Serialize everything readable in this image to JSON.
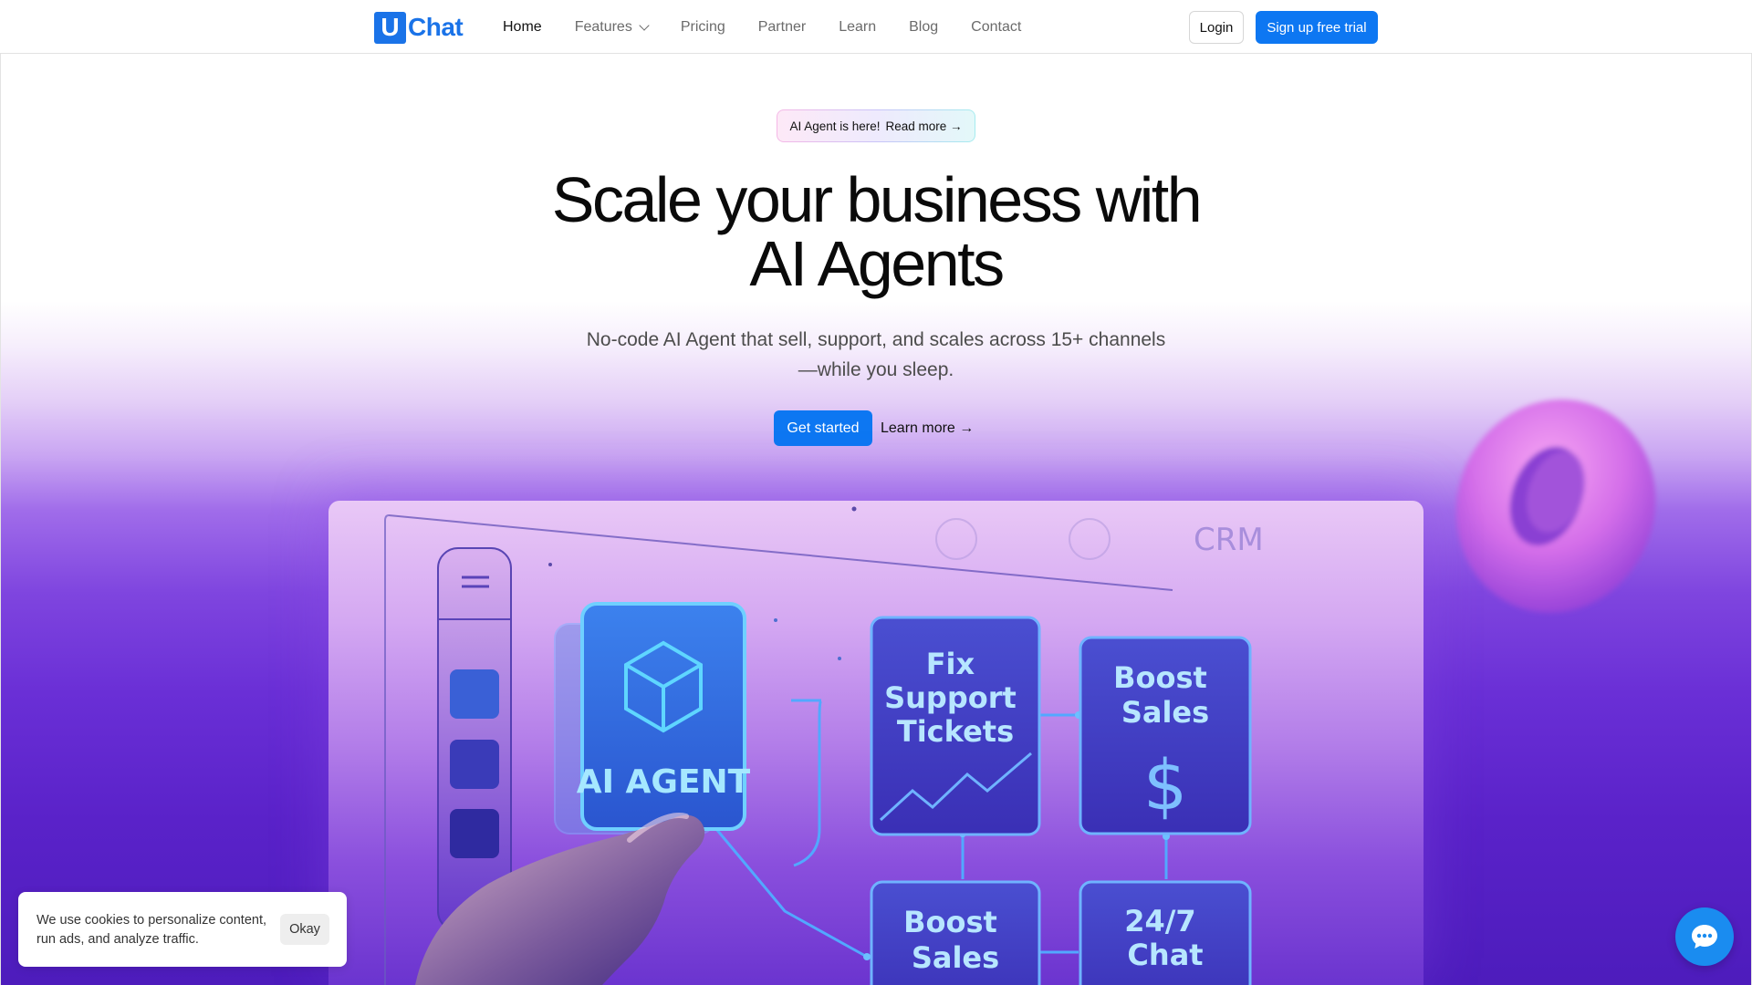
{
  "brand": {
    "logo_letter": "U",
    "logo_text": "Chat",
    "accent": "#1a73e8",
    "button_blue": "#0d77f2"
  },
  "nav": {
    "items": [
      {
        "label": "Home",
        "active": true
      },
      {
        "label": "Features",
        "has_dropdown": true
      },
      {
        "label": "Pricing"
      },
      {
        "label": "Partner"
      },
      {
        "label": "Learn"
      },
      {
        "label": "Blog"
      },
      {
        "label": "Contact"
      }
    ],
    "login_label": "Login",
    "signup_label": "Sign up free trial"
  },
  "announcement": {
    "text": "AI Agent is here!",
    "link": "Read more →"
  },
  "hero": {
    "title_line1": "Scale your business with",
    "title_line2": "AI Agents",
    "subtitle_line1": "No-code AI Agent that sell, support, and scales across 15+ channels",
    "subtitle_line2": "—while you sleep.",
    "cta_primary": "Get started",
    "cta_secondary": "Learn more →"
  },
  "visual": {
    "main_card": "AI AGENT",
    "cards": [
      "Fix Support Tickets",
      "Boost Sales",
      "Boost Sales",
      "24/7 Chat"
    ],
    "crm_label": "CRM"
  },
  "cookie": {
    "text": "We use cookies to personalize content, run ads, and analyze traffic.",
    "button": "Okay"
  },
  "icons": {
    "chat": "chat-bubble-icon",
    "dropdown": "chevron-down-icon",
    "cube": "cube-icon",
    "dollar": "dollar-icon"
  }
}
